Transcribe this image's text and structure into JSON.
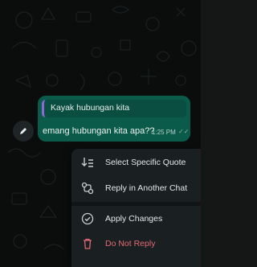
{
  "message": {
    "quote_text": "Kayak hubungan kita",
    "text": "emang hubungan kita apa??",
    "time": "1:25 PM",
    "ticks": "✓✓"
  },
  "menu": {
    "items": [
      {
        "label": "Select Specific Quote",
        "icon": "select-quote-icon"
      },
      {
        "label": "Reply in Another Chat",
        "icon": "reply-another-chat-icon"
      },
      {
        "label": "Apply Changes",
        "icon": "check-circle-icon"
      },
      {
        "label": "Do Not Reply",
        "icon": "trash-icon"
      }
    ]
  },
  "colors": {
    "bubble": "#0b5b4b",
    "quote_bar": "#8a6ad8",
    "danger": "#e06a73",
    "menu_bg": "#1a1f21"
  }
}
